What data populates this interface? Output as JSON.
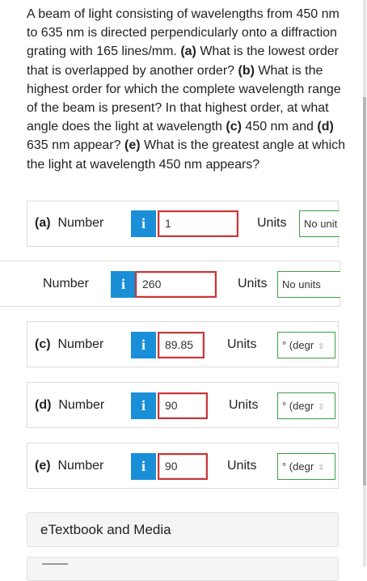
{
  "question": {
    "seg1": "A beam of light consisting of wavelengths from 450 nm to 635 nm is directed perpendicularly onto a diffraction grating with 165 lines/mm. ",
    "a_tag": "(a)",
    "seg2": " What is the lowest order that is overlapped by another order? ",
    "b_tag": "(b)",
    "seg3": " What is the highest order for which the complete wavelength range of the beam is present? In that highest order, at what angle does the light at wavelength ",
    "c_tag": "(c)",
    "seg4": " 450 nm and ",
    "d_tag": "(d)",
    "seg5": " 635 nm appear? ",
    "e_tag": "(e)",
    "seg6": " What is the greatest angle at which the light at wavelength 450 nm appears?"
  },
  "parts": [
    {
      "tag": "(a)",
      "label": "Number",
      "info": "i",
      "value": "1",
      "units_label": "Units",
      "units_value": "No unit"
    },
    {
      "tag": "",
      "label": "Number",
      "info": "i",
      "value": "260",
      "units_label": "Units",
      "units_value": "No units"
    },
    {
      "tag": "(c)",
      "label": "Number",
      "info": "i",
      "value": "89.85",
      "units_label": "Units",
      "units_value": "° (degr"
    },
    {
      "tag": "(d)",
      "label": "Number",
      "info": "i",
      "value": "90",
      "units_label": "Units",
      "units_value": "° (degr"
    },
    {
      "tag": "(e)",
      "label": "Number",
      "info": "i",
      "value": "90",
      "units_label": "Units",
      "units_value": "° (degr"
    }
  ],
  "etextbook": {
    "label": "eTextbook and Media"
  },
  "icons": {
    "info": "info-icon",
    "chevron": "chevron-updown-icon"
  },
  "colors": {
    "info_bg": "#1a8fd8",
    "answer_border": "#c8363a",
    "units_border": "#3c9f47"
  }
}
